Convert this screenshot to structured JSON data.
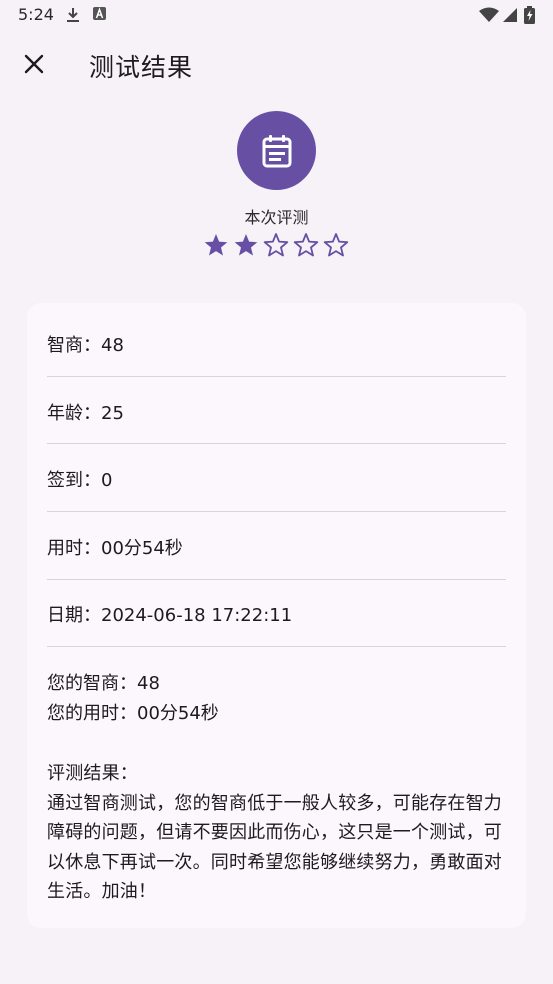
{
  "status_bar": {
    "time": "5:24",
    "icons": [
      "download-icon",
      "text-a-icon",
      "wifi-icon",
      "signal-icon",
      "battery-icon"
    ]
  },
  "app_bar": {
    "close_icon": "close-icon",
    "title": "测试结果"
  },
  "hero": {
    "icon": "clipboard-icon",
    "label": "本次评测",
    "rating": 2,
    "max_rating": 5
  },
  "card": {
    "rows": [
      {
        "label": "智商：",
        "value": "48"
      },
      {
        "label": "年龄：",
        "value": "25"
      },
      {
        "label": "签到：",
        "value": "0"
      },
      {
        "label": "用时：",
        "value": "00分54秒"
      },
      {
        "label": "日期：",
        "value": "2024-06-18 17:22:11"
      }
    ],
    "summary": {
      "iq_label": "您的智商：",
      "iq_value": "48",
      "time_label": "您的用时：",
      "time_value": "00分54秒"
    },
    "result": {
      "label": "评测结果：",
      "text": "通过智商测试，您的智商低于一般人较多，可能存在智力障碍的问题，但请不要因此而伤心，这只是一个测试，可以休息下再试一次。同时希望您能够继续努力，勇敢面对生活。加油！"
    }
  },
  "colors": {
    "accent": "#6750a4",
    "background": "#f6f2f8",
    "card": "#fcf7fd",
    "divider": "#d9d4dc"
  }
}
